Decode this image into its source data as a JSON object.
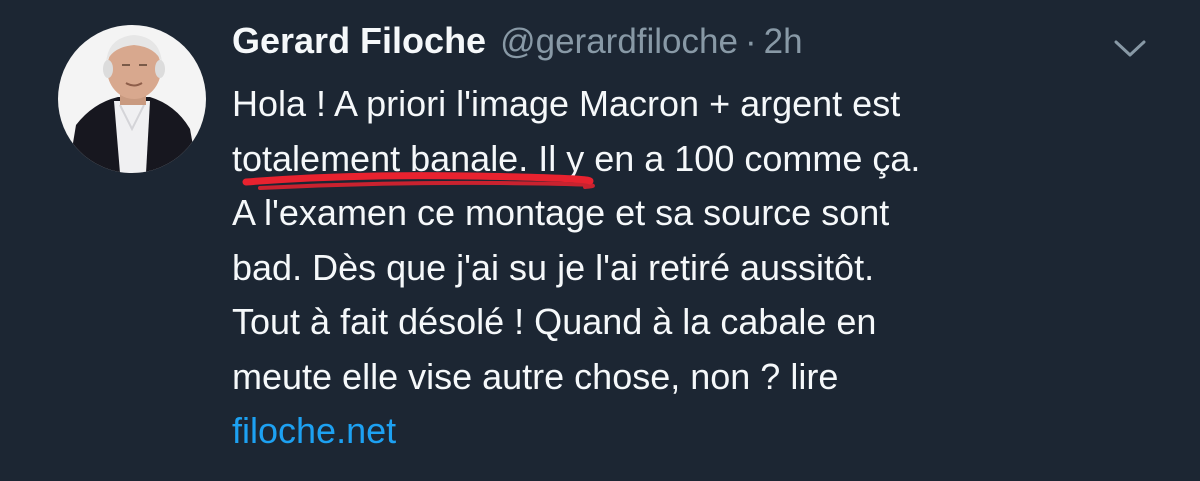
{
  "tweet": {
    "author": {
      "display_name": "Gerard Filoche",
      "handle": "@gerardfiloche",
      "separator": "·",
      "timestamp": "2h"
    },
    "body_lines": [
      "Hola ! A priori l'image Macron + argent est",
      "totalement banale. Il y en a 100 comme ça.",
      "A l'examen ce montage et sa source sont",
      "bad. Dès que j'ai su je l'ai retiré aussitôt.",
      "Tout à fait désolé ! Quand à la cabale en",
      "meute elle vise autre chose, non ? lire"
    ],
    "link_text": "filoche.net"
  },
  "icons": {
    "menu": "chevron-down-icon"
  },
  "colors": {
    "background": "#1c2633",
    "text_primary": "#f5f8fa",
    "text_secondary": "#8899a6",
    "link": "#1da1f2",
    "annotation_red": "#e8222f"
  }
}
